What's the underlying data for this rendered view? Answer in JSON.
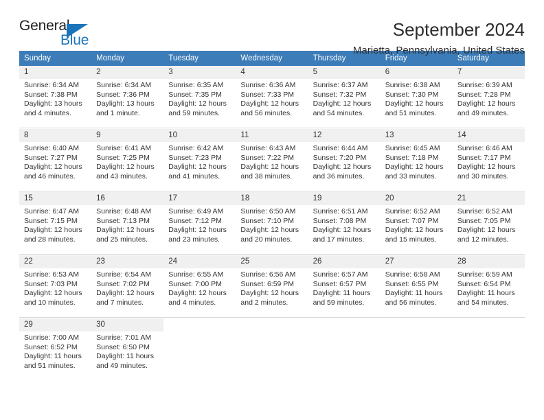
{
  "brand": {
    "name_top": "General",
    "name_bottom": "Blue",
    "triangle_color": "#1b75bb"
  },
  "header": {
    "title": "September 2024",
    "subtitle": "Marietta, Pennsylvania, United States",
    "header_bg": "#3c7cb8",
    "daynum_bg": "#f0f0f0"
  },
  "calendar": {
    "weekdays": [
      "Sunday",
      "Monday",
      "Tuesday",
      "Wednesday",
      "Thursday",
      "Friday",
      "Saturday"
    ],
    "weeks": [
      [
        {
          "day": "1",
          "sunrise": "Sunrise: 6:34 AM",
          "sunset": "Sunset: 7:38 PM",
          "daylight": "Daylight: 13 hours and 4 minutes."
        },
        {
          "day": "2",
          "sunrise": "Sunrise: 6:34 AM",
          "sunset": "Sunset: 7:36 PM",
          "daylight": "Daylight: 13 hours and 1 minute."
        },
        {
          "day": "3",
          "sunrise": "Sunrise: 6:35 AM",
          "sunset": "Sunset: 7:35 PM",
          "daylight": "Daylight: 12 hours and 59 minutes."
        },
        {
          "day": "4",
          "sunrise": "Sunrise: 6:36 AM",
          "sunset": "Sunset: 7:33 PM",
          "daylight": "Daylight: 12 hours and 56 minutes."
        },
        {
          "day": "5",
          "sunrise": "Sunrise: 6:37 AM",
          "sunset": "Sunset: 7:32 PM",
          "daylight": "Daylight: 12 hours and 54 minutes."
        },
        {
          "day": "6",
          "sunrise": "Sunrise: 6:38 AM",
          "sunset": "Sunset: 7:30 PM",
          "daylight": "Daylight: 12 hours and 51 minutes."
        },
        {
          "day": "7",
          "sunrise": "Sunrise: 6:39 AM",
          "sunset": "Sunset: 7:28 PM",
          "daylight": "Daylight: 12 hours and 49 minutes."
        }
      ],
      [
        {
          "day": "8",
          "sunrise": "Sunrise: 6:40 AM",
          "sunset": "Sunset: 7:27 PM",
          "daylight": "Daylight: 12 hours and 46 minutes."
        },
        {
          "day": "9",
          "sunrise": "Sunrise: 6:41 AM",
          "sunset": "Sunset: 7:25 PM",
          "daylight": "Daylight: 12 hours and 43 minutes."
        },
        {
          "day": "10",
          "sunrise": "Sunrise: 6:42 AM",
          "sunset": "Sunset: 7:23 PM",
          "daylight": "Daylight: 12 hours and 41 minutes."
        },
        {
          "day": "11",
          "sunrise": "Sunrise: 6:43 AM",
          "sunset": "Sunset: 7:22 PM",
          "daylight": "Daylight: 12 hours and 38 minutes."
        },
        {
          "day": "12",
          "sunrise": "Sunrise: 6:44 AM",
          "sunset": "Sunset: 7:20 PM",
          "daylight": "Daylight: 12 hours and 36 minutes."
        },
        {
          "day": "13",
          "sunrise": "Sunrise: 6:45 AM",
          "sunset": "Sunset: 7:18 PM",
          "daylight": "Daylight: 12 hours and 33 minutes."
        },
        {
          "day": "14",
          "sunrise": "Sunrise: 6:46 AM",
          "sunset": "Sunset: 7:17 PM",
          "daylight": "Daylight: 12 hours and 30 minutes."
        }
      ],
      [
        {
          "day": "15",
          "sunrise": "Sunrise: 6:47 AM",
          "sunset": "Sunset: 7:15 PM",
          "daylight": "Daylight: 12 hours and 28 minutes."
        },
        {
          "day": "16",
          "sunrise": "Sunrise: 6:48 AM",
          "sunset": "Sunset: 7:13 PM",
          "daylight": "Daylight: 12 hours and 25 minutes."
        },
        {
          "day": "17",
          "sunrise": "Sunrise: 6:49 AM",
          "sunset": "Sunset: 7:12 PM",
          "daylight": "Daylight: 12 hours and 23 minutes."
        },
        {
          "day": "18",
          "sunrise": "Sunrise: 6:50 AM",
          "sunset": "Sunset: 7:10 PM",
          "daylight": "Daylight: 12 hours and 20 minutes."
        },
        {
          "day": "19",
          "sunrise": "Sunrise: 6:51 AM",
          "sunset": "Sunset: 7:08 PM",
          "daylight": "Daylight: 12 hours and 17 minutes."
        },
        {
          "day": "20",
          "sunrise": "Sunrise: 6:52 AM",
          "sunset": "Sunset: 7:07 PM",
          "daylight": "Daylight: 12 hours and 15 minutes."
        },
        {
          "day": "21",
          "sunrise": "Sunrise: 6:52 AM",
          "sunset": "Sunset: 7:05 PM",
          "daylight": "Daylight: 12 hours and 12 minutes."
        }
      ],
      [
        {
          "day": "22",
          "sunrise": "Sunrise: 6:53 AM",
          "sunset": "Sunset: 7:03 PM",
          "daylight": "Daylight: 12 hours and 10 minutes."
        },
        {
          "day": "23",
          "sunrise": "Sunrise: 6:54 AM",
          "sunset": "Sunset: 7:02 PM",
          "daylight": "Daylight: 12 hours and 7 minutes."
        },
        {
          "day": "24",
          "sunrise": "Sunrise: 6:55 AM",
          "sunset": "Sunset: 7:00 PM",
          "daylight": "Daylight: 12 hours and 4 minutes."
        },
        {
          "day": "25",
          "sunrise": "Sunrise: 6:56 AM",
          "sunset": "Sunset: 6:59 PM",
          "daylight": "Daylight: 12 hours and 2 minutes."
        },
        {
          "day": "26",
          "sunrise": "Sunrise: 6:57 AM",
          "sunset": "Sunset: 6:57 PM",
          "daylight": "Daylight: 11 hours and 59 minutes."
        },
        {
          "day": "27",
          "sunrise": "Sunrise: 6:58 AM",
          "sunset": "Sunset: 6:55 PM",
          "daylight": "Daylight: 11 hours and 56 minutes."
        },
        {
          "day": "28",
          "sunrise": "Sunrise: 6:59 AM",
          "sunset": "Sunset: 6:54 PM",
          "daylight": "Daylight: 11 hours and 54 minutes."
        }
      ],
      [
        {
          "day": "29",
          "sunrise": "Sunrise: 7:00 AM",
          "sunset": "Sunset: 6:52 PM",
          "daylight": "Daylight: 11 hours and 51 minutes."
        },
        {
          "day": "30",
          "sunrise": "Sunrise: 7:01 AM",
          "sunset": "Sunset: 6:50 PM",
          "daylight": "Daylight: 11 hours and 49 minutes."
        },
        {
          "day": "",
          "sunrise": "",
          "sunset": "",
          "daylight": ""
        },
        {
          "day": "",
          "sunrise": "",
          "sunset": "",
          "daylight": ""
        },
        {
          "day": "",
          "sunrise": "",
          "sunset": "",
          "daylight": ""
        },
        {
          "day": "",
          "sunrise": "",
          "sunset": "",
          "daylight": ""
        },
        {
          "day": "",
          "sunrise": "",
          "sunset": "",
          "daylight": ""
        }
      ]
    ]
  }
}
